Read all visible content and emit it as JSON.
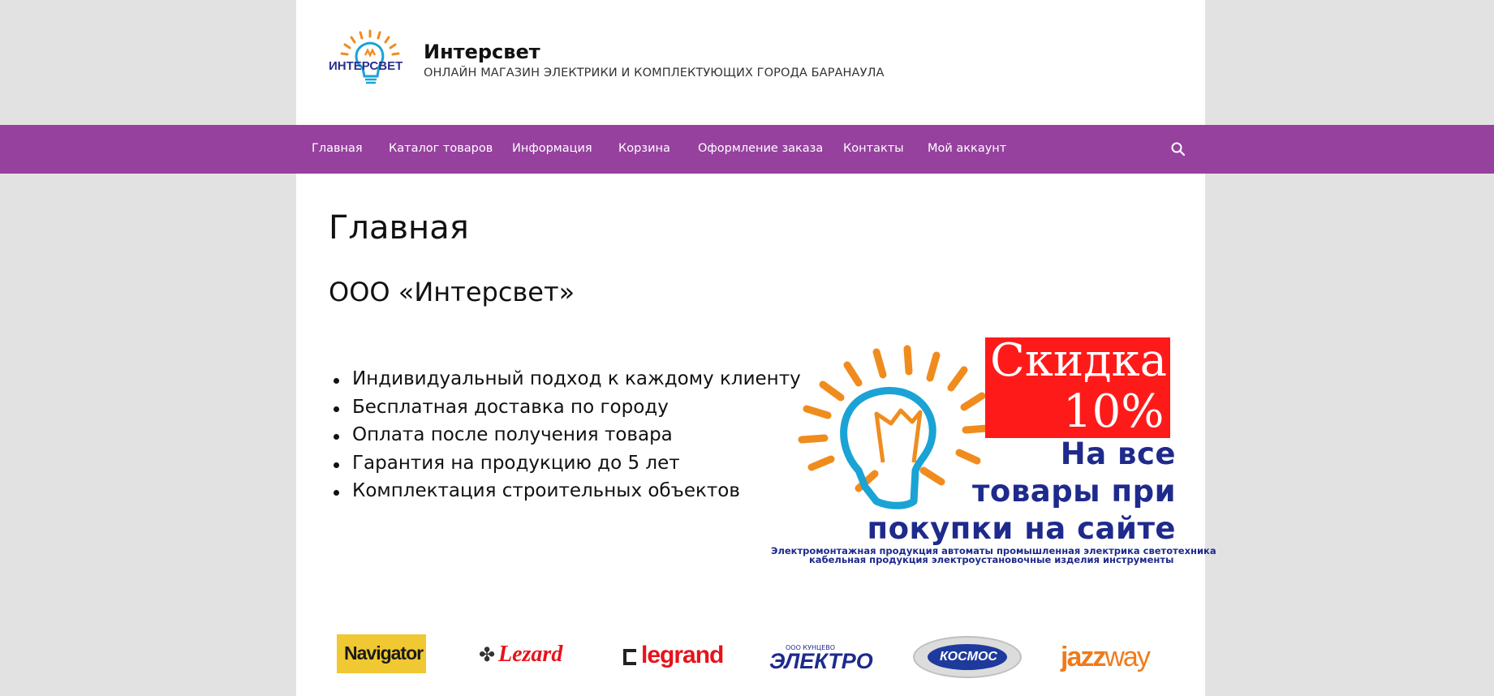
{
  "header": {
    "title": "Интерсвет",
    "description": "ОНЛАЙН МАГАЗИН ЭЛЕКТРИКИ И КОМПЛЕКТУЮЩИХ ГОРОДА БАРАНАУЛА",
    "logo_text": "ИНТЕРСВЕТ"
  },
  "nav": {
    "items": [
      {
        "label": "Главная"
      },
      {
        "label": "Каталог товаров"
      },
      {
        "label": "Информация"
      },
      {
        "label": "Корзина"
      },
      {
        "label": "Оформление заказа"
      },
      {
        "label": "Контакты"
      },
      {
        "label": "Мой аккаунт"
      }
    ]
  },
  "content": {
    "page_title": "Главная",
    "company_title": "ООО «Интерсвет»",
    "features": [
      "Индивидуальный подход к каждому клиенту",
      "Бесплатная доставка по городу",
      "Оплата после получения товара",
      "Гарантия на продукцию до 5 лет",
      "Комплектация строительных объектов"
    ]
  },
  "promo": {
    "line1": "Скидка",
    "line2": "10%",
    "line3": "На все",
    "line4": "товары при",
    "line5": "покупки на сайте",
    "small1": "Электромонтажная продукция автоматы промышленная электрика светотехника",
    "small2": "кабельная продукция  электроустановочные изделия инструменты"
  },
  "brands": {
    "navigator": "Navigator",
    "lezard": "Lezard",
    "legrand": "legrand",
    "electro_top": "ООО КУНЦЕВО",
    "electro": "ЭЛЕКТРО",
    "kosmos": "КОСМОС",
    "jazz1": "jazz",
    "jazz2": "way"
  },
  "colors": {
    "nav_bg": "#96419e",
    "page_bg": "#e2e2e2",
    "promo_red": "#ff1a1a",
    "promo_blue": "#1e2a8c",
    "bulb_orange": "#f08c1e",
    "bulb_blue": "#1aa3d4"
  }
}
